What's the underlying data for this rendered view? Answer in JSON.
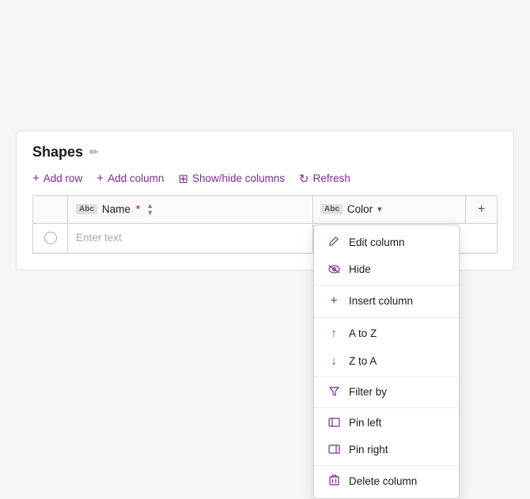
{
  "panel": {
    "title": "Shapes",
    "edit_tooltip": "Edit"
  },
  "toolbar": {
    "add_row": "Add row",
    "add_column": "Add column",
    "show_hide": "Show/hide columns",
    "refresh": "Refresh"
  },
  "table": {
    "col_name_label": "Name",
    "col_name_required": "*",
    "col_color_label": "Color",
    "col_type": "Abc",
    "add_icon": "+",
    "placeholder": "Enter text"
  },
  "dropdown": {
    "items": [
      {
        "id": "edit-column",
        "label": "Edit column",
        "icon": "✏️"
      },
      {
        "id": "hide",
        "label": "Hide",
        "icon": "hide"
      },
      {
        "id": "insert-column",
        "label": "Insert column",
        "icon": "+"
      },
      {
        "id": "a-to-z",
        "label": "A to Z",
        "icon": "↑"
      },
      {
        "id": "z-to-a",
        "label": "Z to A",
        "icon": "↓"
      },
      {
        "id": "filter-by",
        "label": "Filter by",
        "icon": "filter"
      },
      {
        "id": "pin-left",
        "label": "Pin left",
        "icon": "pin-left"
      },
      {
        "id": "pin-right",
        "label": "Pin right",
        "icon": "pin-right"
      },
      {
        "id": "delete-column",
        "label": "Delete column",
        "icon": "delete"
      }
    ]
  },
  "colors": {
    "primary": "#7b2d8b",
    "required": "#c00000"
  }
}
